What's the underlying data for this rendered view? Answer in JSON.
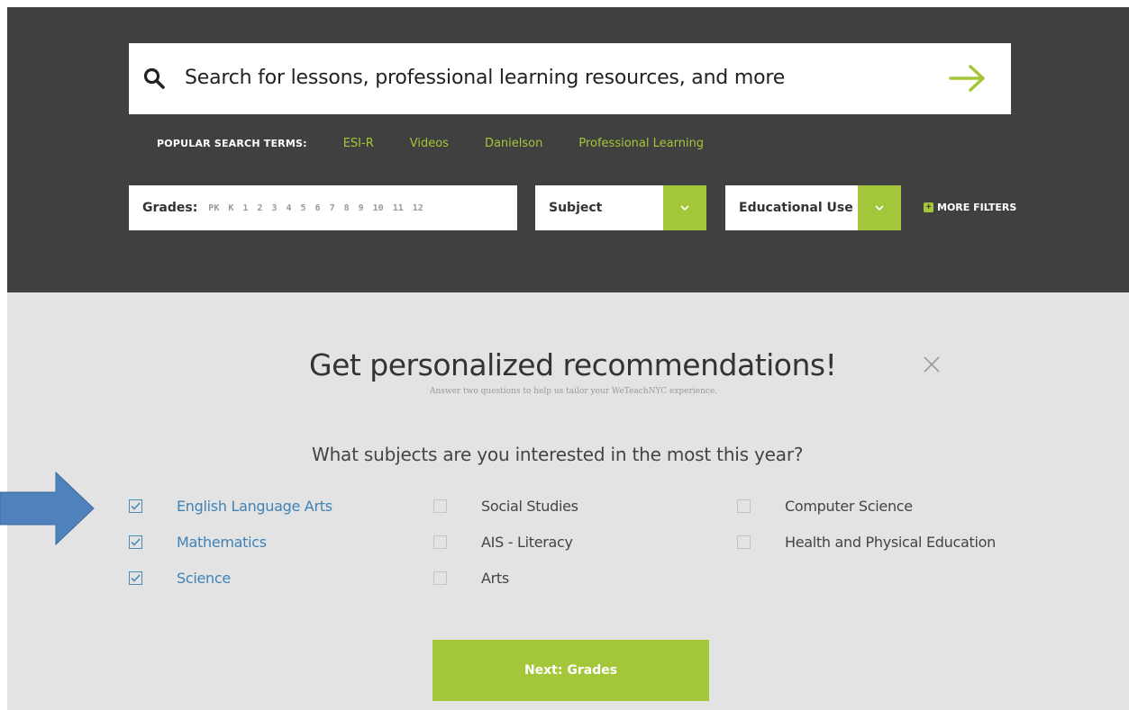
{
  "search": {
    "placeholder": "Search for lessons, professional learning resources, and more"
  },
  "popular": {
    "label": "POPULAR SEARCH TERMS:",
    "terms": [
      "ESI-R",
      "Videos",
      "Danielson",
      "Professional Learning"
    ]
  },
  "filters": {
    "grades_label": "Grades:",
    "grades": [
      "PK",
      "K",
      "1",
      "2",
      "3",
      "4",
      "5",
      "6",
      "7",
      "8",
      "9",
      "10",
      "11",
      "12"
    ],
    "subject_label": "Subject",
    "educational_use_label": "Educational Use",
    "more_filters_label": "MORE FILTERS"
  },
  "recommendations": {
    "title": "Get personalized recommendations!",
    "subtitle": "Answer two questions to help us tailor your WeTeachNYC experience.",
    "question": "What subjects are you interested in the most this year?",
    "subjects": [
      {
        "label": "English Language Arts",
        "checked": true
      },
      {
        "label": "Mathematics",
        "checked": true
      },
      {
        "label": "Science",
        "checked": true
      },
      {
        "label": "Social Studies",
        "checked": false
      },
      {
        "label": "AIS - Literacy",
        "checked": false
      },
      {
        "label": "Arts",
        "checked": false
      },
      {
        "label": "Computer Science",
        "checked": false
      },
      {
        "label": "Health and Physical Education",
        "checked": false
      }
    ],
    "next_button": "Next: Grades"
  },
  "colors": {
    "accent_green": "#a4c639",
    "dark_header": "#404040",
    "panel_gray": "#e3e3e3",
    "checked_blue": "#3f83b5",
    "annotation_arrow": "#4f81bd"
  },
  "icons": {
    "search": "search-icon",
    "submit": "arrow-right-icon",
    "dropdown": "chevron-down-icon",
    "more": "plus-icon",
    "close": "close-icon",
    "check": "checkmark-icon",
    "annotation": "annotation-arrow-icon"
  }
}
